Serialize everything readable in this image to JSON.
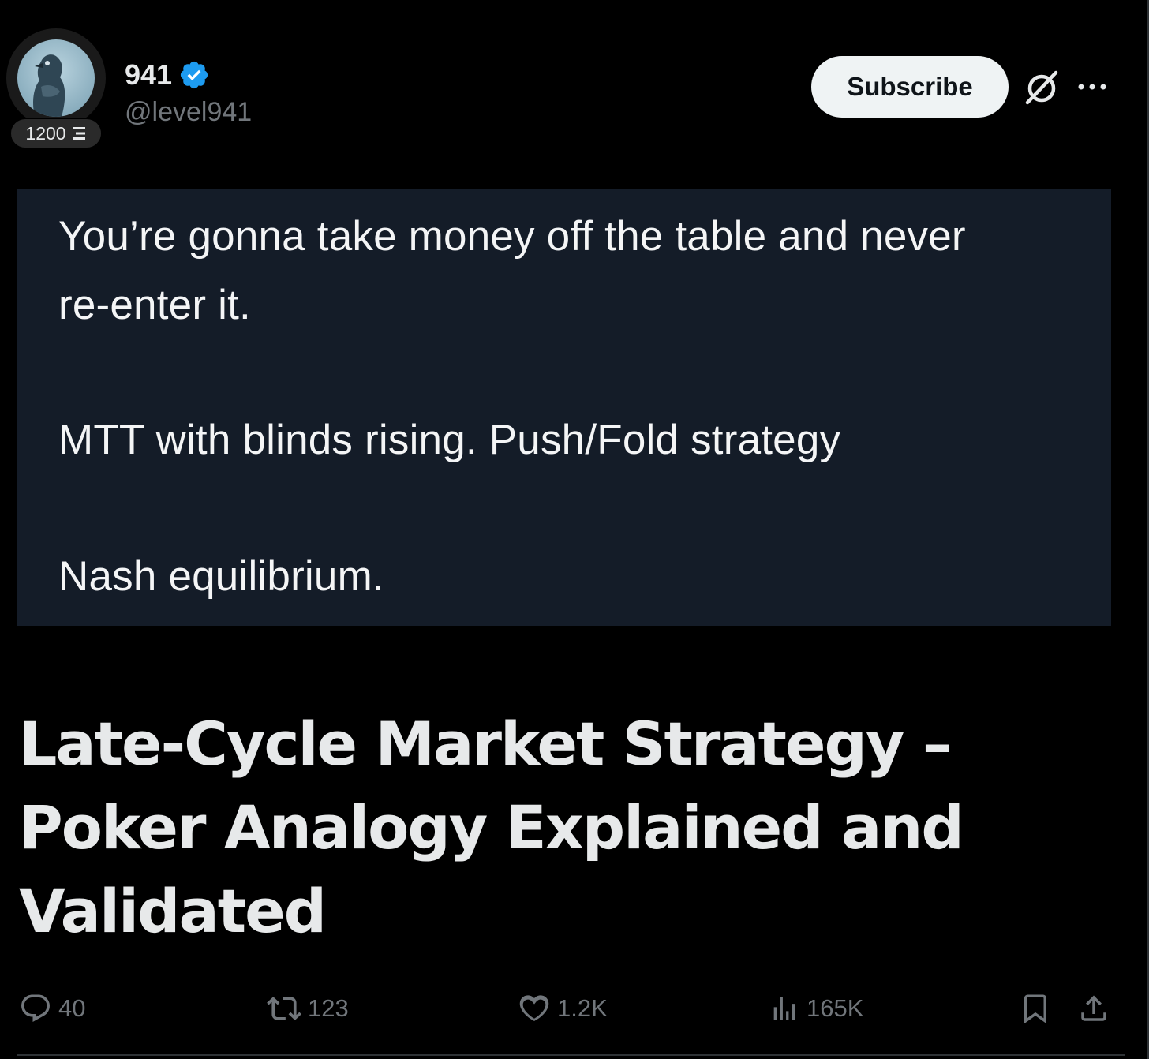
{
  "author": {
    "display_name": "941",
    "handle": "@level941",
    "level_badge": "1200",
    "verified": true,
    "verified_color": "#1d9bf0"
  },
  "header": {
    "subscribe_label": "Subscribe",
    "icons": [
      "grok-icon",
      "more-icon"
    ]
  },
  "quote": {
    "lines": [
      "You’re gonna take money off the table and never",
      "re-enter it.",
      "MTT with blinds rising. Push/Fold strategy",
      "Nash equilibrium."
    ]
  },
  "article": {
    "title_lines": [
      "Late-Cycle Market Strategy –",
      "Poker Analogy Explained and",
      "Validated"
    ]
  },
  "actions": {
    "replies": "40",
    "reposts": "123",
    "likes": "1.2K",
    "views": "165K",
    "icons": [
      "reply-icon",
      "repost-icon",
      "like-icon",
      "views-icon",
      "bookmark-icon",
      "share-icon"
    ]
  },
  "colors": {
    "background": "#000000",
    "text": "#e7e9ea",
    "muted": "#71767b",
    "quote_background": "#141c28"
  }
}
